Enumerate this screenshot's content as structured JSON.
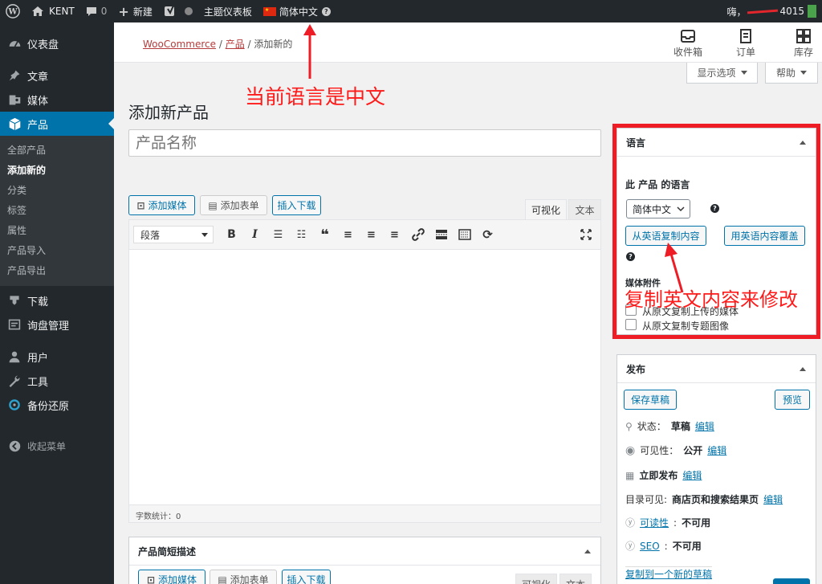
{
  "admin_bar": {
    "site_name": "KENT",
    "comments_count": "0",
    "new_label": "新建",
    "theme_dashboard": "主题仪表板",
    "language": "简体中文",
    "greeting": "嗨，",
    "username_partial": "4015"
  },
  "sidebar": {
    "items": [
      {
        "label": "仪表盘",
        "icon": "dashboard-icon"
      },
      {
        "label": "文章",
        "icon": "pin-icon"
      },
      {
        "label": "媒体",
        "icon": "media-icon"
      },
      {
        "label": "产品",
        "icon": "box-icon",
        "current": true
      },
      {
        "label": "下载",
        "icon": "download-icon"
      },
      {
        "label": "询盘管理",
        "icon": "inquiry-icon"
      },
      {
        "label": "用户",
        "icon": "user-icon"
      },
      {
        "label": "工具",
        "icon": "wrench-icon"
      },
      {
        "label": "备份还原",
        "icon": "backup-icon"
      },
      {
        "label": "收起菜单",
        "icon": "collapse-icon"
      }
    ],
    "submenu": [
      "全部产品",
      "添加新的",
      "分类",
      "标签",
      "属性",
      "产品导入",
      "产品导出"
    ]
  },
  "topbar": {
    "breadcrumb": {
      "root": "WooCommerce",
      "sep": "/",
      "parent": "产品",
      "current": "添加新的"
    },
    "icons": [
      "收件箱",
      "订单",
      "库存"
    ]
  },
  "screen_options": "显示选项",
  "help": "帮助",
  "annotations": {
    "top": "当前语言是中文",
    "side": "复制英文内容来修改"
  },
  "page": {
    "title": "添加新产品",
    "product_name_placeholder": "产品名称"
  },
  "editor": {
    "add_media": "添加媒体",
    "add_form": "添加表单",
    "insert_download": "插入下载",
    "tab_visual": "可视化",
    "tab_text": "文本",
    "format_select": "段落",
    "word_count": "字数统计：0"
  },
  "language_box": {
    "title": "语言",
    "product_language_label": "此 产品 的语言",
    "selected_language": "简体中文",
    "copy_from_english": "从英语复制内容",
    "overwrite_with_english": "用英语内容覆盖",
    "media_attachments": "媒体附件",
    "copy_uploaded_media": "从原文复制上传的媒体",
    "copy_featured_image": "从原文复制专题图像"
  },
  "publish_box": {
    "title": "发布",
    "save_draft": "保存草稿",
    "preview": "预览",
    "status_label": "状态：",
    "status_value": "草稿",
    "visibility_label": "可见性：",
    "visibility_value": "公开",
    "publish_label": "立即发布",
    "catalog_label": "目录可见:",
    "catalog_value": "商店页和搜索结果页",
    "readability_label": "可读性",
    "readability_value": "不可用",
    "seo_label": "SEO",
    "seo_value": "不可用",
    "edit": "编辑",
    "copy_to_draft": "复制到一个新的草稿"
  },
  "short_desc_box": {
    "title": "产品简短描述",
    "add_media": "添加媒体",
    "add_form": "添加表单",
    "insert_download": "插入下载",
    "tab_visual": "可视化",
    "tab_text": "文本"
  },
  "colors": {
    "admin_bar": "#23282d",
    "accent": "#0073aa",
    "annotation": "#ee1c25",
    "breadcrumb_link": "#b43c3c"
  }
}
